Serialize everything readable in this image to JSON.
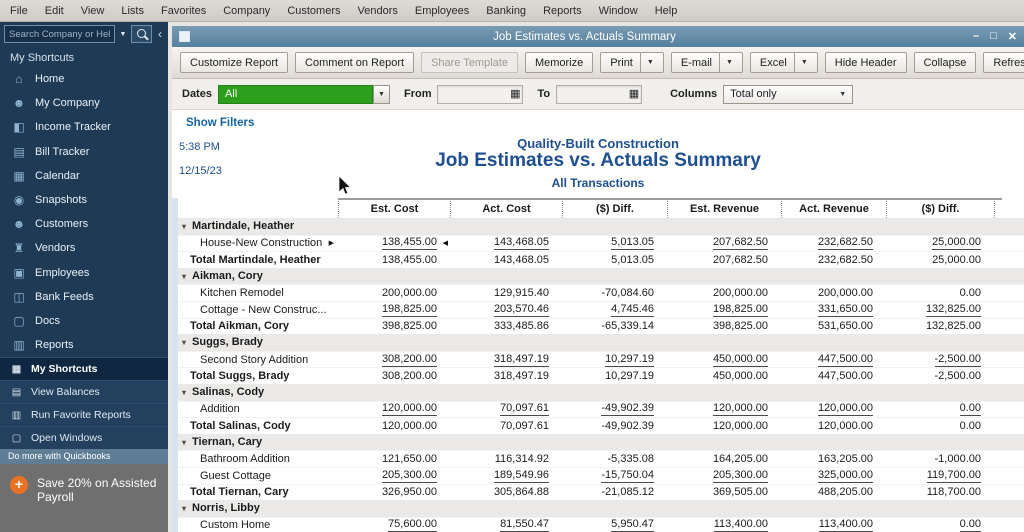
{
  "menubar": {
    "items": [
      "File",
      "Edit",
      "View",
      "Lists",
      "Favorites",
      "Company",
      "Customers",
      "Vendors",
      "Employees",
      "Banking",
      "Reports",
      "Window",
      "Help"
    ]
  },
  "sidebar": {
    "search_placeholder": "Search Company or Help",
    "section_label": "My Shortcuts",
    "items": [
      {
        "label": "Home",
        "icon": "home-icon",
        "glyph": "⌂"
      },
      {
        "label": "My Company",
        "icon": "my-company-icon",
        "glyph": "☻"
      },
      {
        "label": "Income Tracker",
        "icon": "income-tracker-icon",
        "glyph": "◧"
      },
      {
        "label": "Bill Tracker",
        "icon": "bill-tracker-icon",
        "glyph": "▤"
      },
      {
        "label": "Calendar",
        "icon": "calendar-icon",
        "glyph": "▦"
      },
      {
        "label": "Snapshots",
        "icon": "snapshots-icon",
        "glyph": "◉"
      },
      {
        "label": "Customers",
        "icon": "customers-icon",
        "glyph": "☻"
      },
      {
        "label": "Vendors",
        "icon": "vendors-icon",
        "glyph": "♜"
      },
      {
        "label": "Employees",
        "icon": "employees-icon",
        "glyph": "▣"
      },
      {
        "label": "Bank Feeds",
        "icon": "bank-feeds-icon",
        "glyph": "◫"
      },
      {
        "label": "Docs",
        "icon": "docs-icon",
        "glyph": "▢"
      },
      {
        "label": "Reports",
        "icon": "reports-icon",
        "glyph": "▥"
      }
    ],
    "bottom_items": [
      {
        "label": "My Shortcuts",
        "icon": "my-shortcuts-icon",
        "glyph": "▦",
        "active": true
      },
      {
        "label": "View Balances",
        "icon": "view-balances-icon",
        "glyph": "▤",
        "active": false
      },
      {
        "label": "Run Favorite Reports",
        "icon": "run-favorite-reports-icon",
        "glyph": "▥",
        "active": false
      },
      {
        "label": "Open Windows",
        "icon": "open-windows-icon",
        "glyph": "▢",
        "active": false
      }
    ],
    "promo_header": "Do more with Quickbooks",
    "promo_text": "Save 20% on Assisted Payroll"
  },
  "window": {
    "title": "Job Estimates vs. Actuals Summary",
    "controls": {
      "minimize": "–",
      "maximize": "□",
      "close": "✕"
    }
  },
  "toolbar": {
    "buttons": [
      {
        "label": "Customize Report",
        "dropdown": false,
        "disabled": false
      },
      {
        "label": "Comment on Report",
        "dropdown": false,
        "disabled": false
      },
      {
        "label": "Share Template",
        "dropdown": false,
        "disabled": true
      },
      {
        "label": "Memorize",
        "dropdown": false,
        "disabled": false
      },
      {
        "label": "Print",
        "dropdown": true,
        "disabled": false
      },
      {
        "label": "E-mail",
        "dropdown": true,
        "disabled": false
      },
      {
        "label": "Excel",
        "dropdown": true,
        "disabled": false
      },
      {
        "label": "Hide Header",
        "dropdown": false,
        "disabled": false
      },
      {
        "label": "Collapse",
        "dropdown": false,
        "disabled": false
      },
      {
        "label": "Refresh",
        "dropdown": false,
        "disabled": false
      }
    ]
  },
  "filters": {
    "dates_label": "Dates",
    "dates_value": "All",
    "from_label": "From",
    "from_value": "",
    "to_label": "To",
    "to_value": "",
    "columns_label": "Columns",
    "columns_value": "Total only",
    "show_filters": "Show Filters"
  },
  "report": {
    "time": "5:38 PM",
    "date": "12/15/23",
    "company": "Quality-Built Construction",
    "title": "Job Estimates vs. Actuals Summary",
    "subtitle": "All Transactions"
  },
  "table": {
    "columns": [
      "Est. Cost",
      "Act. Cost",
      "($) Diff.",
      "Est. Revenue",
      "Act. Revenue",
      "($) Diff."
    ],
    "rows": [
      {
        "type": "group",
        "label": "Martindale, Heather"
      },
      {
        "type": "detail",
        "label": "House-New Construction",
        "values": [
          "138,455.00",
          "143,468.05",
          "5,013.05",
          "207,682.50",
          "232,682.50",
          "25,000.00"
        ],
        "underline": true,
        "marker": true
      },
      {
        "type": "total",
        "label": "Total Martindale, Heather",
        "values": [
          "138,455.00",
          "143,468.05",
          "5,013.05",
          "207,682.50",
          "232,682.50",
          "25,000.00"
        ]
      },
      {
        "type": "group",
        "label": "Aikman, Cory"
      },
      {
        "type": "detail",
        "label": "Kitchen Remodel",
        "values": [
          "200,000.00",
          "129,915.40",
          "-70,084.60",
          "200,000.00",
          "200,000.00",
          "0.00"
        ]
      },
      {
        "type": "detail",
        "label": "Cottage - New Construc...",
        "values": [
          "198,825.00",
          "203,570.46",
          "4,745.46",
          "198,825.00",
          "331,650.00",
          "132,825.00"
        ],
        "underline": true
      },
      {
        "type": "total",
        "label": "Total Aikman, Cory",
        "values": [
          "398,825.00",
          "333,485.86",
          "-65,339.14",
          "398,825.00",
          "531,650.00",
          "132,825.00"
        ]
      },
      {
        "type": "group",
        "label": "Suggs, Brady"
      },
      {
        "type": "detail",
        "label": "Second Story Addition",
        "values": [
          "308,200.00",
          "318,497.19",
          "10,297.19",
          "450,000.00",
          "447,500.00",
          "-2,500.00"
        ],
        "underline": true
      },
      {
        "type": "total",
        "label": "Total Suggs, Brady",
        "values": [
          "308,200.00",
          "318,497.19",
          "10,297.19",
          "450,000.00",
          "447,500.00",
          "-2,500.00"
        ]
      },
      {
        "type": "group",
        "label": "Salinas, Cody"
      },
      {
        "type": "detail",
        "label": "Addition",
        "values": [
          "120,000.00",
          "70,097.61",
          "-49,902.39",
          "120,000.00",
          "120,000.00",
          "0.00"
        ],
        "underline": true
      },
      {
        "type": "total",
        "label": "Total Salinas, Cody",
        "values": [
          "120,000.00",
          "70,097.61",
          "-49,902.39",
          "120,000.00",
          "120,000.00",
          "0.00"
        ]
      },
      {
        "type": "group",
        "label": "Tiernan, Cary"
      },
      {
        "type": "detail",
        "label": "Bathroom Addition",
        "values": [
          "121,650.00",
          "116,314.92",
          "-5,335.08",
          "164,205.00",
          "163,205.00",
          "-1,000.00"
        ]
      },
      {
        "type": "detail",
        "label": "Guest Cottage",
        "values": [
          "205,300.00",
          "189,549.96",
          "-15,750.04",
          "205,300.00",
          "325,000.00",
          "119,700.00"
        ],
        "underline": true
      },
      {
        "type": "total",
        "label": "Total Tiernan, Cary",
        "values": [
          "326,950.00",
          "305,864.88",
          "-21,085.12",
          "369,505.00",
          "488,205.00",
          "118,700.00"
        ]
      },
      {
        "type": "group",
        "label": "Norris, Libby"
      },
      {
        "type": "detail",
        "label": "Custom Home",
        "values": [
          "75,600.00",
          "81,550.47",
          "5,950.47",
          "113,400.00",
          "113,400.00",
          "0.00"
        ],
        "underline": true
      }
    ]
  },
  "colors": {
    "qb_green": "#2CA01C",
    "titlebar_blue": "#54809f",
    "sidebar_navy": "#1e3a55",
    "report_blue": "#1d4f91",
    "promo_orange": "#e87122"
  }
}
